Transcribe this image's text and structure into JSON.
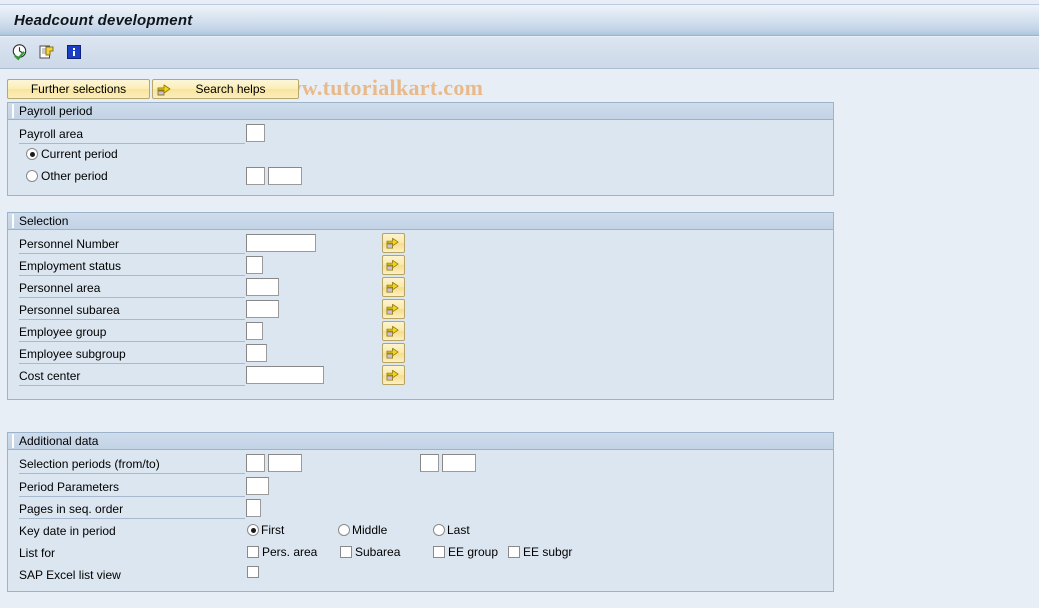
{
  "window": {
    "title": "Headcount development"
  },
  "toolbar": {
    "icons": [
      {
        "name": "execute-clock-icon",
        "title": "Execute"
      },
      {
        "name": "copy-icon",
        "title": "Get Variant"
      },
      {
        "name": "info-icon",
        "title": "Information"
      }
    ],
    "watermark": "© www.tutorialkart.com"
  },
  "actions": {
    "further_selections_label": "Further selections",
    "search_helps_label": "Search helps"
  },
  "sections": {
    "payroll_period": {
      "title": "Payroll period",
      "payroll_area_label": "Payroll area",
      "payroll_area_value": "",
      "current_period_label": "Current period",
      "other_period_label": "Other period",
      "selected_period": "current",
      "other_period_value_1": "",
      "other_period_value_2": ""
    },
    "selection": {
      "title": "Selection",
      "rows": [
        {
          "label": "Personnel Number",
          "value": "",
          "input_width": 70
        },
        {
          "label": "Employment status",
          "value": "",
          "input_width": 17
        },
        {
          "label": "Personnel area",
          "value": "",
          "input_width": 33
        },
        {
          "label": "Personnel subarea",
          "value": "",
          "input_width": 33
        },
        {
          "label": "Employee group",
          "value": "",
          "input_width": 17
        },
        {
          "label": "Employee subgroup",
          "value": "",
          "input_width": 21
        },
        {
          "label": "Cost center",
          "value": "",
          "input_width": 78
        }
      ],
      "multi_select_icon": "multi-select-arrow-icon"
    },
    "additional_data": {
      "title": "Additional data",
      "selection_periods_label": "Selection periods (from/to)",
      "selection_periods_from_a": "",
      "selection_periods_from_b": "",
      "selection_periods_to_a": "",
      "selection_periods_to_b": "",
      "period_parameters_label": "Period Parameters",
      "period_parameters_value": "",
      "pages_seq_label": "Pages in seq. order",
      "pages_seq_value": "",
      "key_date_label": "Key date in period",
      "key_date_options": [
        "First",
        "Middle",
        "Last"
      ],
      "key_date_selected": "First",
      "list_for_label": "List for",
      "list_for_options": [
        {
          "label": "Pers. area",
          "checked": false
        },
        {
          "label": "Subarea",
          "checked": false
        },
        {
          "label": "EE group",
          "checked": false
        },
        {
          "label": "EE subgr",
          "checked": false
        }
      ],
      "excel_label": "SAP Excel list view",
      "excel_checked": false
    }
  },
  "colors": {
    "page_background": "#e8eef5",
    "panel_background": "#dce6f0",
    "panel_border": "#9cb3cc",
    "button_yellow": "#fbeeb8",
    "watermark": "#e8b98a",
    "titlebar_gradient_end": "#adc5de"
  }
}
